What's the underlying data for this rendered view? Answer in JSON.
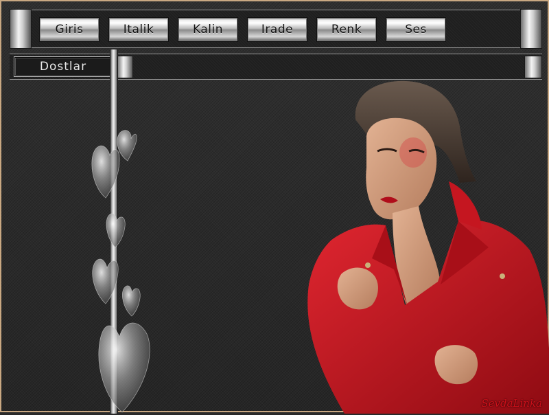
{
  "toolbar": {
    "buttons": [
      {
        "label": "Giris"
      },
      {
        "label": "Italik"
      },
      {
        "label": "Kalin"
      },
      {
        "label": "Irade"
      },
      {
        "label": "Renk"
      },
      {
        "label": "Ses"
      }
    ]
  },
  "friends": {
    "label": "Dostlar"
  },
  "signature": "SevdaLinka",
  "colors": {
    "frame": "#c9a882",
    "background": "#2a2a2a",
    "coat": "#c8141e"
  }
}
